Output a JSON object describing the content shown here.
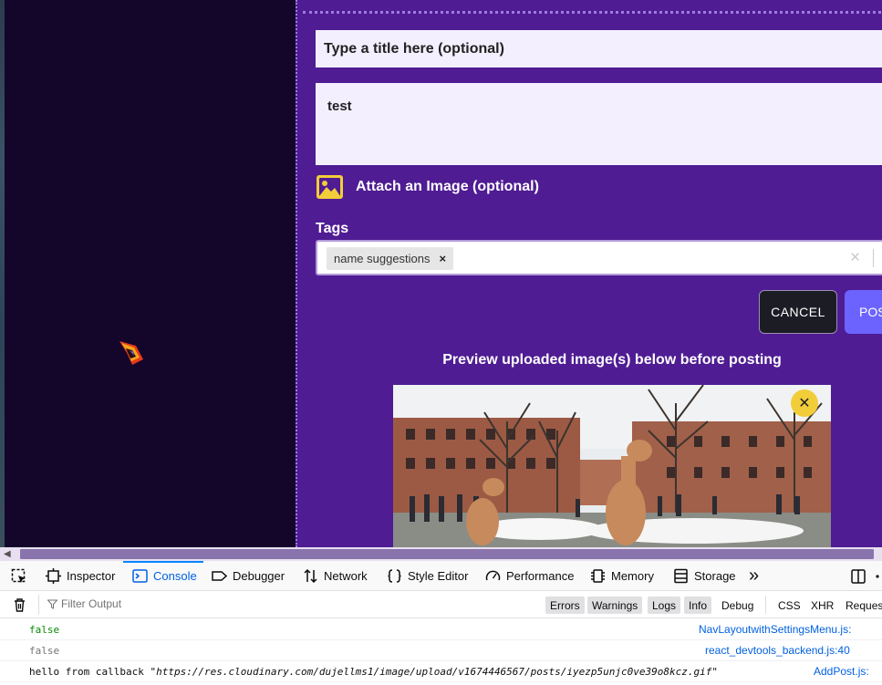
{
  "form": {
    "title_placeholder": "Type a title here (optional)",
    "body_value": "test",
    "attach_label": "Attach an Image (optional)",
    "tags_label": "Tags",
    "tags": [
      "name suggestions"
    ],
    "tag_remove_glyph": "×",
    "tags_clear_glyph": "×",
    "cancel_label": "CANCEL",
    "post_label": "POS",
    "preview_heading": "Preview uploaded image(s) below before posting",
    "remove_image_glyph": "✕"
  },
  "devtools": {
    "tabs": {
      "inspector": "Inspector",
      "console": "Console",
      "debugger": "Debugger",
      "network": "Network",
      "style_editor": "Style Editor",
      "performance": "Performance",
      "memory": "Memory",
      "storage": "Storage",
      "overflow": "»"
    },
    "filter_placeholder": "Filter Output",
    "levels": {
      "errors": "Errors",
      "warnings": "Warnings",
      "logs": "Logs",
      "info": "Info",
      "debug": "Debug",
      "css": "CSS",
      "xhr": "XHR",
      "requests": "Request"
    },
    "logs": [
      {
        "message": "false",
        "source": "NavLayoutwithSettingsMenu.js:"
      },
      {
        "message": "false",
        "source": "react_devtools_backend.js:40"
      },
      {
        "message_prefix": "hello from callback ",
        "message_string": "\"https://res.cloudinary.com/dujellms1/image/upload/v1674446567/posts/iyezp5unjc0ve39o8kcz.gif\"",
        "source": "AddPost.js:"
      }
    ]
  },
  "colors": {
    "panel_purple": "#4f1c93",
    "left_dark": "#14052a",
    "cancel_bg": "#1c1c24",
    "post_bg": "#6c63ff",
    "accent_yellow": "#f2cd3a",
    "console_blue": "#0060df"
  },
  "icons": [
    "image-icon",
    "close-icon",
    "logo-icon",
    "inspector-icon",
    "console-icon",
    "debugger-icon",
    "network-icon",
    "style-editor-icon",
    "performance-icon",
    "memory-icon",
    "storage-icon",
    "trash-icon",
    "filter-icon",
    "dock-icon",
    "more-icon"
  ]
}
